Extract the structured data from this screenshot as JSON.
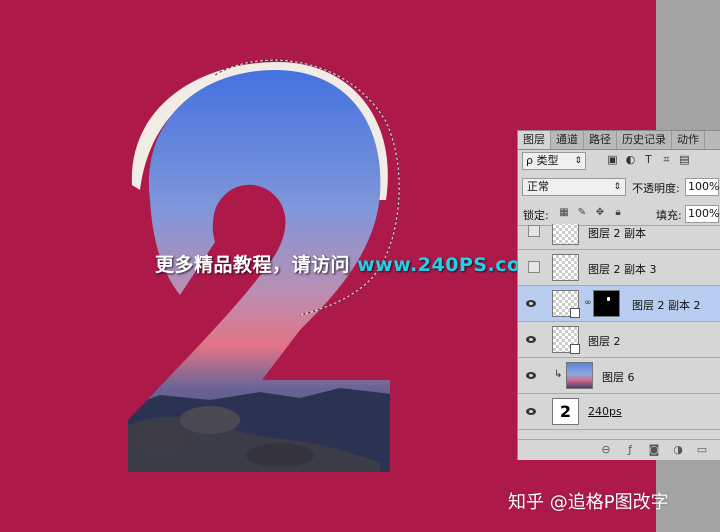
{
  "watermark": {
    "prefix": "更多精品教程，请访问 ",
    "url": "www.240PS.com"
  },
  "credit": "知乎 @追格P图改字",
  "panel": {
    "tabs": [
      "图层",
      "通道",
      "路径",
      "历史记录",
      "动作"
    ],
    "filter_kind": "ρ 类型",
    "blend_mode": "正常",
    "opacity_label": "不透明度:",
    "opacity_value": "100%",
    "lock_label": "锁定:",
    "fill_label": "填充:",
    "fill_value": "100%",
    "layers": [
      {
        "name": "图层 2 副本",
        "visible": false
      },
      {
        "name": "图层 2 副本 3",
        "visible": false
      },
      {
        "name": "图层 2 副本 2",
        "visible": true,
        "selected": true,
        "has_mask": true
      },
      {
        "name": "图层 2",
        "visible": true
      },
      {
        "name": "图层 6",
        "visible": true,
        "clipped": true
      },
      {
        "name": "240ps",
        "visible": true,
        "thumb_text": "2"
      }
    ]
  },
  "colors": {
    "canvas": "#ad1a4a",
    "pasteboard": "#a3a3a3",
    "selection_highlight": "#b9cdf0",
    "url_color": "#1ed3e8"
  },
  "icons": [
    "image-filter-icon",
    "adjust-filter-icon",
    "text-filter-icon",
    "shape-filter-icon",
    "smart-filter-icon",
    "lock-transparent-icon",
    "lock-paint-icon",
    "lock-position-icon",
    "lock-all-icon",
    "link-icon",
    "fx-icon",
    "mask-icon",
    "adjustment-icon",
    "folder-icon"
  ]
}
